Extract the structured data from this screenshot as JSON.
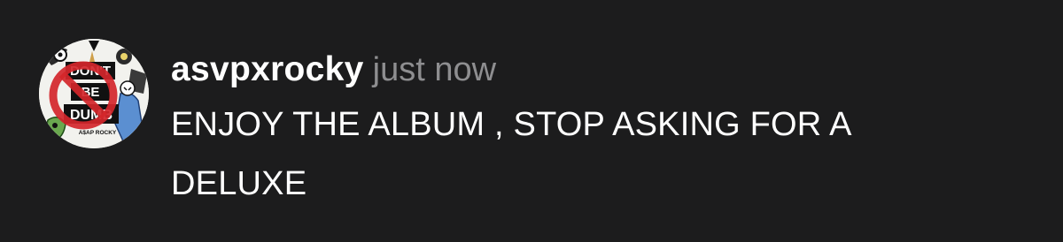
{
  "post": {
    "author": {
      "username": "asvpxrocky",
      "avatar": {
        "icon": "album-cover-avatar",
        "artwork_text": [
          "DON'T",
          "BE",
          "DUMB",
          "A$AP ROCKY"
        ],
        "colors": {
          "background": "#f2f2ee",
          "prohibition_sign": "#d4262b",
          "figure_blue": "#5b8fd1",
          "figure_green": "#6aa84f",
          "ink": "#111111"
        }
      }
    },
    "timestamp": "just now",
    "message_lines": [
      "ENJOY THE ALBUM , STOP ASKING FOR A",
      "DELUXE"
    ]
  },
  "theme": {
    "background": "#1c1c1d",
    "username_color": "#ffffff",
    "timestamp_color": "#8e8e90",
    "message_color": "#ffffff"
  }
}
